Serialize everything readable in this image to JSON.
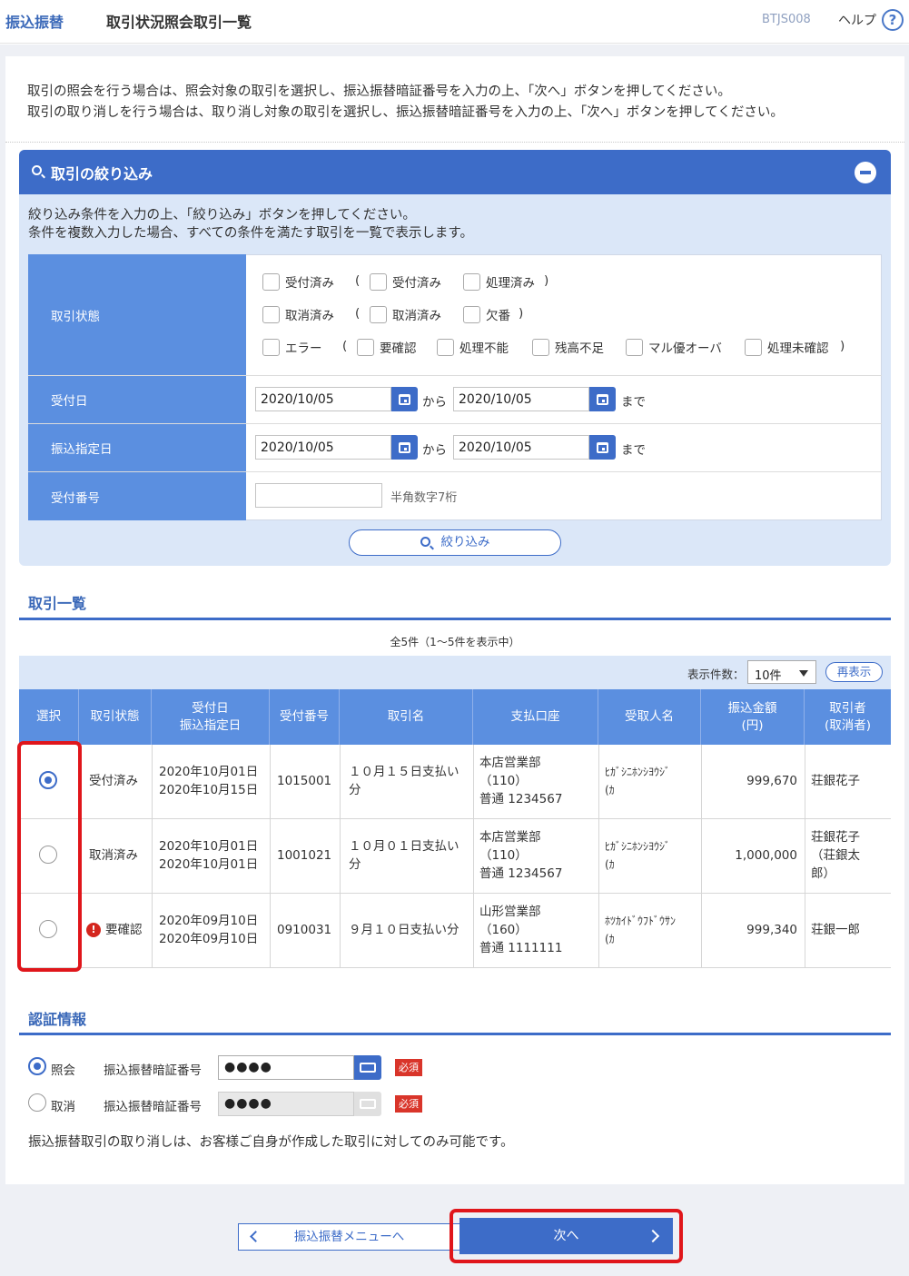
{
  "header": {
    "section": "振込振替",
    "title": "取引状況照会取引一覧",
    "screen_code": "BTJS008",
    "help": "ヘルプ",
    "help_icon": "?"
  },
  "intro": {
    "line1": "取引の照会を行う場合は、照会対象の取引を選択し、振込振替暗証番号を入力の上、「次へ」ボタンを押してください。",
    "line2": "取引の取り消しを行う場合は、取り消し対象の取引を選択し、振込振替暗証番号を入力の上、「次へ」ボタンを押してください。"
  },
  "filter": {
    "title": "取引の絞り込み",
    "desc1": "絞り込み条件を入力の上、「絞り込み」ボタンを押してください。",
    "desc2": "条件を複数入力した場合、すべての条件を満たす取引を一覧で表示します。",
    "status_label": "取引状態",
    "accepted": "受付済み",
    "accepted_sub": "受付済み",
    "processed": "処理済み",
    "cancelled": "取消済み",
    "cancelled_sub": "取消済み",
    "missing": "欠番",
    "error": "エラー",
    "needs_check": "要確認",
    "unprocessable": "処理不能",
    "insufficient": "残高不足",
    "over_limit": "マル優オーバ",
    "unconfirmed": "処理未確認",
    "open_paren": "(",
    "close_paren": ")",
    "accept_date_label": "受付日",
    "transfer_date_label": "振込指定日",
    "accept_no_label": "受付番号",
    "date_from": "2020/10/05",
    "date_to": "2020/10/05",
    "date_from2": "2020/10/05",
    "date_to2": "2020/10/05",
    "kara": "から",
    "made": "まで",
    "kara2": "から",
    "made2": "まで",
    "accept_no_value": "",
    "accept_no_hint": "半角数字7桁",
    "button": "絞り込み"
  },
  "list": {
    "title": "取引一覧",
    "count": "全5件（1～5件を表示中）",
    "per_page_label": "表示件数：",
    "per_page_value": "10件",
    "redisplay": "再表示",
    "columns": [
      "選択",
      "取引状態",
      "受付日",
      "振込指定日",
      "受付番号",
      "取引名",
      "支払口座",
      "受取人名",
      "振込金額",
      "(円)",
      "取引者",
      "(取消者)"
    ],
    "rows": [
      {
        "status": "受付済み",
        "accept_date": "2020年10月01日",
        "transfer_date": "2020年10月15日",
        "number": "1015001",
        "name1": "１０月１５日支払い",
        "name2": "分",
        "acc1": "本店営業部",
        "acc2": "（110）",
        "acc3": "普通 1234567",
        "payee1": "ﾋｶﾞｼﾆﾎﾝｼﾖｳｼﾞ",
        "payee2": "(ｶ",
        "amount": "999,670",
        "user1": "荘銀花子",
        "user2": "",
        "user3": ""
      },
      {
        "status": "取消済み",
        "accept_date": "2020年10月01日",
        "transfer_date": "2020年10月01日",
        "number": "1001021",
        "name1": "１０月０１日支払い",
        "name2": "分",
        "acc1": "本店営業部",
        "acc2": "（110）",
        "acc3": "普通 1234567",
        "payee1": "ﾋｶﾞｼﾆﾎﾝｼﾖｳｼﾞ",
        "payee2": "(ｶ",
        "amount": "1,000,000",
        "user1": "荘銀花子",
        "user2": "（荘銀太",
        "user3": "郎）"
      },
      {
        "status": "要確認",
        "accept_date": "2020年09月10日",
        "transfer_date": "2020年09月10日",
        "number": "0910031",
        "name1": "９月１０日支払い分",
        "name2": "",
        "acc1": "山形営業部",
        "acc2": "（160）",
        "acc3": "普通 1111111",
        "payee1": "ﾎﾂｶｲﾄﾞｳﾌﾄﾞｳｻﾝ",
        "payee2": "(ｶ",
        "amount": "999,340",
        "user1": "荘銀一郎",
        "user2": "",
        "user3": ""
      }
    ],
    "info_icon": "!"
  },
  "auth": {
    "title": "認証情報",
    "inquiry": "照会",
    "cancel": "取消",
    "pin_label": "振込振替暗証番号",
    "pin_label2": "振込振替暗証番号",
    "pin_value": "●●●●",
    "pin_value2": "●●●●",
    "required": "必須",
    "required2": "必須",
    "note": "振込振替取引の取り消しは、お客様ご自身が作成した取引に対してのみ可能です。"
  },
  "footer": {
    "back": "振込振替メニューへ",
    "next": "次へ"
  },
  "colors": {
    "primary": "#3d6cc8",
    "header_cell": "#5b8fe0",
    "panel_bg": "#dbe7f8",
    "highlight": "#e0161b",
    "required": "#d9352a"
  }
}
